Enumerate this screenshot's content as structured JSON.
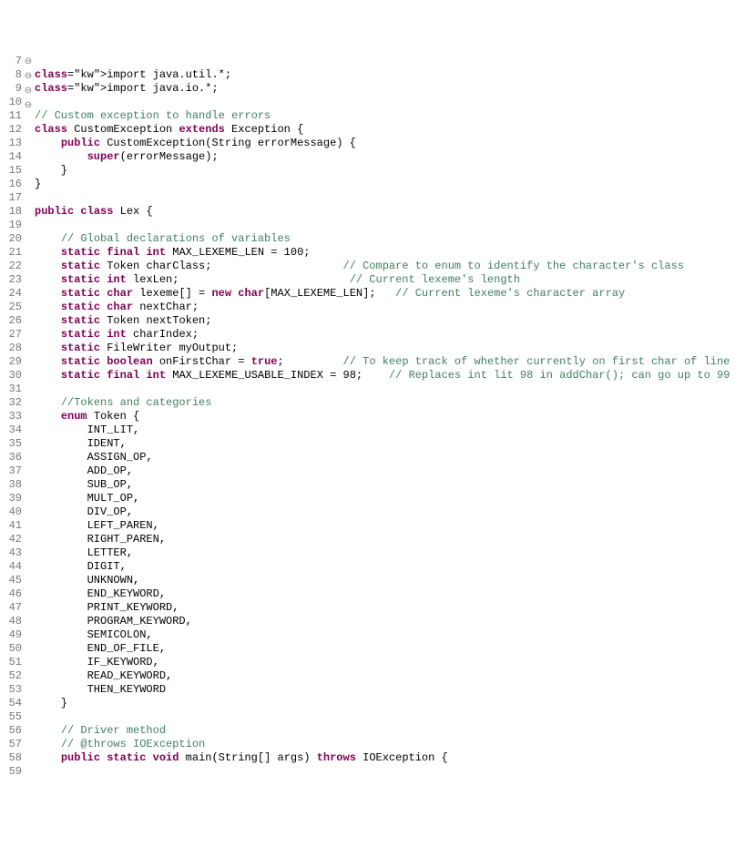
{
  "lines": [
    {
      "n": "7",
      "fold": "",
      "t": ""
    },
    {
      "n": "8",
      "fold": "⊖",
      "t": "import java.util.*;"
    },
    {
      "n": "9",
      "fold": "",
      "t": "import java.io.*;"
    },
    {
      "n": "10",
      "fold": "",
      "t": ""
    },
    {
      "n": "11",
      "fold": "",
      "t": "// Custom exception to handle errors"
    },
    {
      "n": "12",
      "fold": "",
      "t": "class CustomException extends Exception {"
    },
    {
      "n": "13",
      "fold": "⊖",
      "t": "    public CustomException(String errorMessage) {"
    },
    {
      "n": "14",
      "fold": "",
      "t": "        super(errorMessage);"
    },
    {
      "n": "15",
      "fold": "",
      "t": "    }"
    },
    {
      "n": "16",
      "fold": "",
      "t": "}"
    },
    {
      "n": "17",
      "fold": "",
      "t": ""
    },
    {
      "n": "18",
      "fold": "",
      "t": "public class Lex {"
    },
    {
      "n": "19",
      "fold": "",
      "t": ""
    },
    {
      "n": "20",
      "fold": "",
      "t": "    // Global declarations of variables"
    },
    {
      "n": "21",
      "fold": "",
      "t": "    static final int MAX_LEXEME_LEN = 100;"
    },
    {
      "n": "22",
      "fold": "",
      "t": "    static Token charClass;                    // Compare to enum to identify the character's class"
    },
    {
      "n": "23",
      "fold": "",
      "t": "    static int lexLen;                          // Current lexeme's length"
    },
    {
      "n": "24",
      "fold": "",
      "t": "    static char lexeme[] = new char[MAX_LEXEME_LEN];   // Current lexeme's character array"
    },
    {
      "n": "25",
      "fold": "",
      "t": "    static char nextChar;"
    },
    {
      "n": "26",
      "fold": "",
      "t": "    static Token nextToken;"
    },
    {
      "n": "27",
      "fold": "",
      "t": "    static int charIndex;"
    },
    {
      "n": "28",
      "fold": "",
      "t": "    static FileWriter myOutput;"
    },
    {
      "n": "29",
      "fold": "",
      "t": "    static boolean onFirstChar = true;         // To keep track of whether currently on first char of line"
    },
    {
      "n": "30",
      "fold": "",
      "t": "    static final int MAX_LEXEME_USABLE_INDEX = 98;    // Replaces int lit 98 in addChar(); can go up to 99"
    },
    {
      "n": "31",
      "fold": "",
      "t": ""
    },
    {
      "n": "32",
      "fold": "",
      "t": "    //Tokens and categories"
    },
    {
      "n": "33",
      "fold": "⊖",
      "t": "    enum Token {"
    },
    {
      "n": "34",
      "fold": "",
      "t": "        INT_LIT,"
    },
    {
      "n": "35",
      "fold": "",
      "t": "        IDENT,"
    },
    {
      "n": "36",
      "fold": "",
      "t": "        ASSIGN_OP,"
    },
    {
      "n": "37",
      "fold": "",
      "t": "        ADD_OP,"
    },
    {
      "n": "38",
      "fold": "",
      "t": "        SUB_OP,"
    },
    {
      "n": "39",
      "fold": "",
      "t": "        MULT_OP,"
    },
    {
      "n": "40",
      "fold": "",
      "t": "        DIV_OP,"
    },
    {
      "n": "41",
      "fold": "",
      "t": "        LEFT_PAREN,"
    },
    {
      "n": "42",
      "fold": "",
      "t": "        RIGHT_PAREN,"
    },
    {
      "n": "43",
      "fold": "",
      "t": "        LETTER,"
    },
    {
      "n": "44",
      "fold": "",
      "t": "        DIGIT,"
    },
    {
      "n": "45",
      "fold": "",
      "t": "        UNKNOWN,"
    },
    {
      "n": "46",
      "fold": "",
      "t": "        END_KEYWORD,"
    },
    {
      "n": "47",
      "fold": "",
      "t": "        PRINT_KEYWORD,"
    },
    {
      "n": "48",
      "fold": "",
      "t": "        PROGRAM_KEYWORD,"
    },
    {
      "n": "49",
      "fold": "",
      "t": "        SEMICOLON,"
    },
    {
      "n": "50",
      "fold": "",
      "t": "        END_OF_FILE,"
    },
    {
      "n": "51",
      "fold": "",
      "t": "        IF_KEYWORD,"
    },
    {
      "n": "52",
      "fold": "",
      "t": "        READ_KEYWORD,"
    },
    {
      "n": "53",
      "fold": "",
      "t": "        THEN_KEYWORD"
    },
    {
      "n": "54",
      "fold": "",
      "t": "    }"
    },
    {
      "n": "55",
      "fold": "",
      "t": ""
    },
    {
      "n": "56",
      "fold": "",
      "t": "    // Driver method"
    },
    {
      "n": "57",
      "fold": "",
      "t": "    // @throws IOException"
    },
    {
      "n": "58",
      "fold": "⊖",
      "t": "    public static void main(String[] args) throws IOException {"
    },
    {
      "n": "59",
      "fold": "",
      "t": ""
    }
  ],
  "keywords": [
    "import",
    "class",
    "extends",
    "public",
    "super",
    "static",
    "final",
    "int",
    "char",
    "new",
    "boolean",
    "true",
    "enum",
    "void",
    "throws"
  ]
}
